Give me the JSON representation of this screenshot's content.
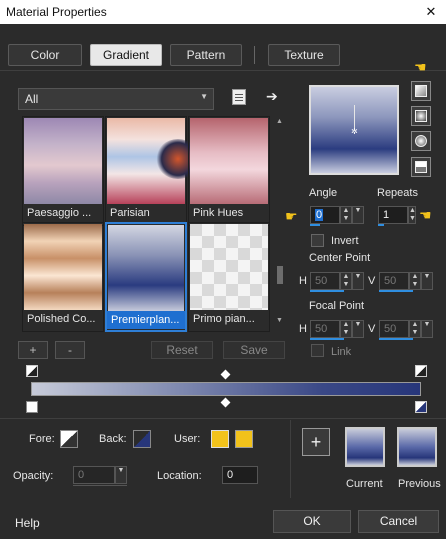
{
  "window": {
    "title": "Material Properties",
    "close": "✕"
  },
  "tabs": [
    "Color",
    "Gradient",
    "Pattern",
    "Texture"
  ],
  "active_tab": "Gradient",
  "library": {
    "dropdown_value": "All",
    "thumbnails": [
      {
        "label": "Paesaggio ...",
        "selected": false
      },
      {
        "label": "Parisian",
        "selected": false
      },
      {
        "label": "Pink Hues",
        "selected": false
      },
      {
        "label": "Polished Co...",
        "selected": false
      },
      {
        "label": "Premierplan...",
        "selected": true
      },
      {
        "label": "Primo pian...",
        "selected": false
      }
    ],
    "add": "+",
    "remove": "-",
    "reset": "Reset",
    "save": "Save"
  },
  "params": {
    "angle_label": "Angle",
    "angle_value": "0",
    "repeats_label": "Repeats",
    "repeats_value": "1",
    "invert_label": "Invert",
    "center_label": "Center Point",
    "focal_label": "Focal Point",
    "h_label": "H",
    "v_label": "V",
    "center_h": "50",
    "center_v": "50",
    "focal_h": "50",
    "focal_v": "50",
    "link_label": "Link"
  },
  "stops": {
    "fore_label": "Fore:",
    "back_label": "Back:",
    "user_label": "User:",
    "opacity_label": "Opacity:",
    "opacity_value": "0",
    "location_label": "Location:",
    "location_value": "0",
    "user_color": "#f2c21b"
  },
  "swatches": {
    "add": "+",
    "current_label": "Current",
    "previous_label": "Previous"
  },
  "footer": {
    "help": "Help",
    "ok": "OK",
    "cancel": "Cancel"
  }
}
